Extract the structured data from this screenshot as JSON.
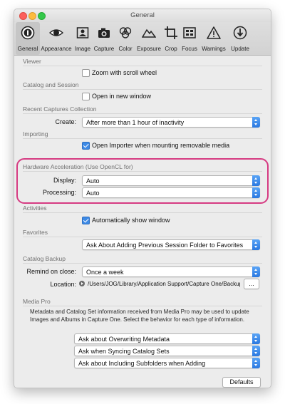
{
  "window": {
    "title": "General"
  },
  "toolbar": {
    "items": [
      {
        "label": "General",
        "icon": "general-icon"
      },
      {
        "label": "Appearance",
        "icon": "eye-icon"
      },
      {
        "label": "Image",
        "icon": "image-icon"
      },
      {
        "label": "Capture",
        "icon": "camera-icon"
      },
      {
        "label": "Color",
        "icon": "color-circles-icon"
      },
      {
        "label": "Exposure",
        "icon": "exposure-icon"
      },
      {
        "label": "Crop",
        "icon": "crop-icon"
      },
      {
        "label": "Focus",
        "icon": "focus-icon"
      },
      {
        "label": "Warnings",
        "icon": "warning-icon"
      },
      {
        "label": "Update",
        "icon": "update-icon"
      }
    ],
    "selected": "General"
  },
  "viewer": {
    "heading": "Viewer",
    "zoom_label": "Zoom with scroll wheel",
    "zoom_checked": false
  },
  "catalog_session": {
    "heading": "Catalog and Session",
    "open_new_label": "Open in new window",
    "open_new_checked": false
  },
  "recent": {
    "heading": "Recent Captures Collection",
    "create_label": "Create:",
    "create_value": "After more than 1 hour of inactivity"
  },
  "importing": {
    "heading": "Importing",
    "open_importer_label": "Open Importer when mounting removable media",
    "open_importer_checked": true
  },
  "hardware": {
    "heading": "Hardware Acceleration (Use OpenCL for)",
    "display_label": "Display:",
    "display_value": "Auto",
    "processing_label": "Processing:",
    "processing_value": "Auto",
    "highlight_color": "#d63a82"
  },
  "activities": {
    "heading": "Activities",
    "auto_show_label": "Automatically show window",
    "auto_show_checked": true
  },
  "favorites": {
    "heading": "Favorites",
    "value": "Ask About Adding Previous Session Folder to Favorites"
  },
  "catalog_backup": {
    "heading": "Catalog Backup",
    "remind_label": "Remind on close:",
    "remind_value": "Once a week",
    "location_label": "Location:",
    "location_path": "/Users/JOG/Library/Application Support/Capture One/Backups",
    "browse_label": "..."
  },
  "media_pro": {
    "heading": "Media Pro",
    "description": "Metadata and Catalog Set information received from Media Pro may be used to update Images and Albums in Capture One. Select the behavior for each type of information.",
    "metadata_value": "Ask about Overwriting Metadata",
    "catalog_sets_value": "Ask when Syncing Catalog Sets",
    "subfolders_value": "Ask about Including Subfolders when Adding"
  },
  "defaults_label": "Defaults",
  "colors": {
    "accent": "#3d8ae6",
    "window_bg": "#ececec",
    "toolbar_selected": "#c6c6c6"
  }
}
